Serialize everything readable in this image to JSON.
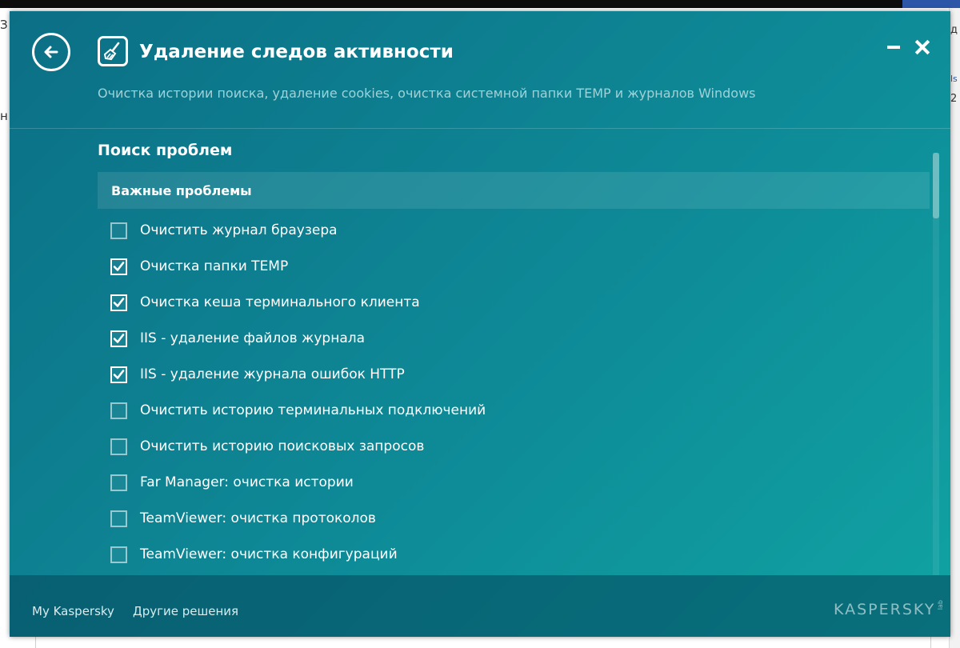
{
  "background": {
    "frag_1": "З",
    "frag_2": "н",
    "frag_right_1": "д",
    "frag_right_2": "ls",
    "frag_right_3": "2"
  },
  "window": {
    "title": "Удаление следов активности",
    "subtitle": "Очистка истории поиска, удаление cookies, очистка системной папки TEMP и журналов Windows",
    "back_icon": "back-arrow-icon",
    "app_icon": "broom-icon",
    "accent_color": "#0e8a97"
  },
  "section": {
    "title": "Поиск проблем"
  },
  "group": {
    "title": "Важные проблемы",
    "items": [
      {
        "label": "Очистить журнал браузера",
        "checked": false
      },
      {
        "label": "Очистка папки TEMP",
        "checked": true
      },
      {
        "label": "Очистка кеша терминального клиента",
        "checked": true
      },
      {
        "label": "IIS - удаление файлов журнала",
        "checked": true
      },
      {
        "label": "IIS - удаление журнала ошибок HTTP",
        "checked": true
      },
      {
        "label": "Очистить историю терминальных подключений",
        "checked": false
      },
      {
        "label": "Очистить историю поисковых запросов",
        "checked": false
      },
      {
        "label": "Far Manager: очистка истории",
        "checked": false
      },
      {
        "label": "TeamViewer: очистка протоколов",
        "checked": false
      },
      {
        "label": "TeamViewer: очистка конфигураций",
        "checked": false
      }
    ]
  },
  "footer": {
    "link_my_kaspersky": "My Kaspersky",
    "link_other_solutions": "Другие решения",
    "brand": "KASPERSKY",
    "brand_suffix": "lab"
  }
}
